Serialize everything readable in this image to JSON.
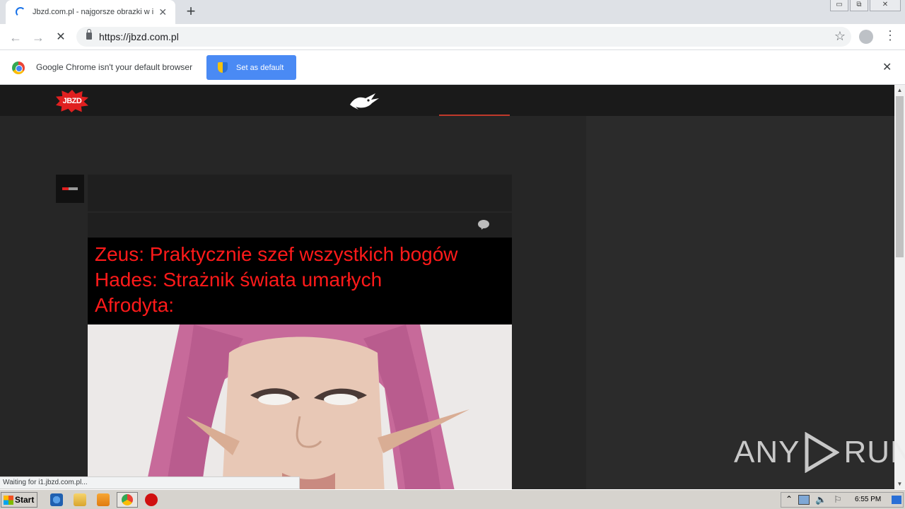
{
  "browser": {
    "tab_title": "Jbzd.com.pl - najgorsze obrazki w internecie!",
    "tab_close": "✕",
    "new_tab": "+",
    "url": "https://jbzd.com.pl",
    "window_buttons": {
      "minimize": "▭",
      "restore": "⧉",
      "close": "✕"
    }
  },
  "infobar": {
    "message": "Google Chrome isn't your default browser",
    "button": "Set as default",
    "close": "✕"
  },
  "post": {
    "caption_lines": [
      "Zeus: Praktycznie szef wszystkich bogów",
      "Hades: Strażnik świata umarłych",
      "Afrodyta:"
    ]
  },
  "status_bar": "Waiting for i1.jbzd.com.pl...",
  "logo_text": "JBZD",
  "watermark": {
    "left": "ANY",
    "right": "RUN"
  },
  "taskbar": {
    "start": "Start",
    "clock": "6:55 PM"
  },
  "colors": {
    "accent": "#e02020",
    "caption_text": "#ff1a1a",
    "chrome_blue": "#4a8af4"
  }
}
